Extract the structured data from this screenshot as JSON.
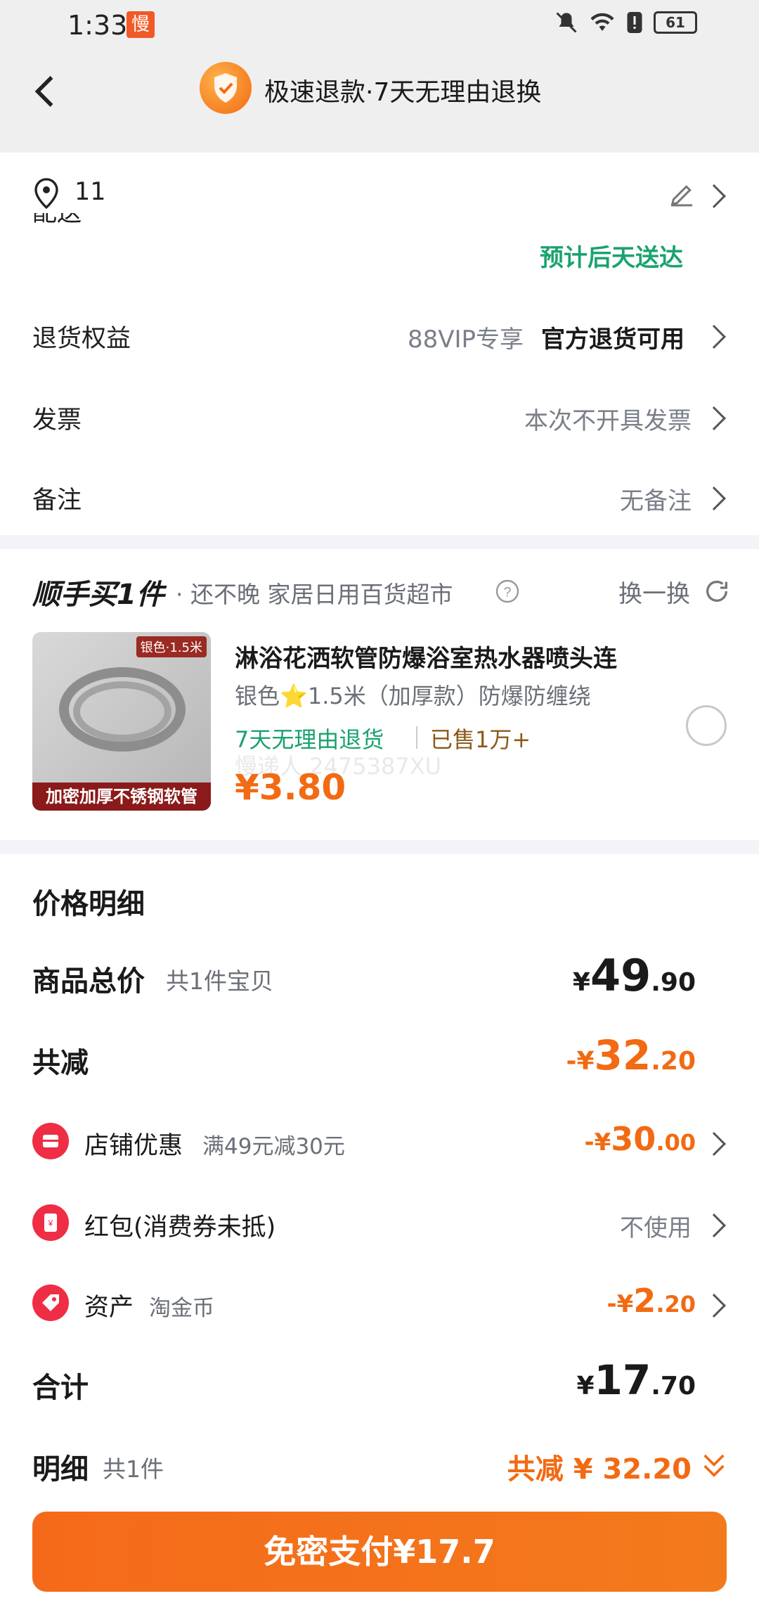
{
  "status_bar": {
    "time": "1:33",
    "slow_badge": "慢",
    "battery": "61"
  },
  "header": {
    "title": "极速退款·7天无理由退换"
  },
  "address": {
    "text": "11"
  },
  "delivery": {
    "label": "配送",
    "estimate": "预计后天送达"
  },
  "options": [
    {
      "label": "退货权益",
      "prefix": "88VIP专享",
      "value": "官方退货可用"
    },
    {
      "label": "发票",
      "value": "本次不开具发票"
    },
    {
      "label": "备注",
      "value": "无备注"
    }
  ],
  "shunshou": {
    "title": "顺手买1件",
    "subtitle": "· 还不晚 家居日用百货超市",
    "swap": "换一换",
    "product": {
      "name": "淋浴花洒软管防爆浴室热水器喷头连",
      "spec": "银色⭐1.5米（加厚款）防爆防缠绕",
      "return": "7天无理由退货",
      "sold": "已售1万+",
      "price": "¥3.80",
      "img_tag": "银色·1.5米",
      "img_banner": "加密加厚不锈钢软管",
      "watermark": "慢递人 2475387XU"
    }
  },
  "price_detail": {
    "title": "价格明细",
    "total": {
      "label": "商品总价",
      "sub": "共1件宝贝",
      "yen": "¥",
      "int": "49",
      "dec": ".90"
    },
    "discount": {
      "label": "共减",
      "prefix": "-¥",
      "int": "32",
      "dec": ".20"
    },
    "shop": {
      "label": "店铺优惠",
      "sub": "满49元减30元",
      "prefix": "-¥",
      "int": "30",
      "dec": ".00"
    },
    "redpacket": {
      "label": "红包(消费券未抵)",
      "value": "不使用"
    },
    "asset": {
      "label": "资产",
      "sub": "淘金币",
      "prefix": "-¥",
      "int": "2",
      "dec": ".20"
    },
    "sum": {
      "label": "合计",
      "yen": "¥",
      "int": "17",
      "dec": ".70"
    },
    "detail": {
      "label": "明细",
      "sub": "共1件",
      "value": "共减 ¥ 32.20"
    }
  },
  "pay_button": "免密支付¥17.7",
  "colors": {
    "accent": "#f26a12",
    "green": "#1aa36e",
    "red": "#ef2d44"
  }
}
